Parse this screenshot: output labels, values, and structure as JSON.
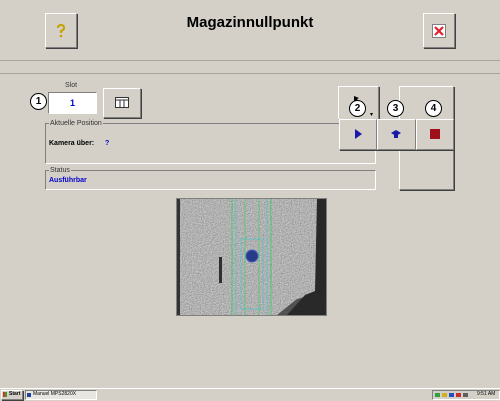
{
  "window": {
    "title": "Magazinnullpunkt"
  },
  "toolbar": {
    "help_icon": "question-icon",
    "close_icon": "close-x-icon"
  },
  "slot": {
    "label": "Slot",
    "value": "1"
  },
  "position_group": {
    "title": "Aktuelle Position",
    "camera_label": "Kamera über:",
    "camera_value": "?"
  },
  "status_group": {
    "title": "Status",
    "value": "Ausführbar"
  },
  "callouts": {
    "c1": "1",
    "c2": "2",
    "c3": "3",
    "c4": "4"
  },
  "taskbar": {
    "start_label": "Start",
    "task_label": "Manuel MPS2820X",
    "time": "9:51 AM"
  },
  "colors": {
    "accent_blue": "#0000cc",
    "play_blue": "#1a1aa8",
    "stop_red": "#a0101a",
    "close_red": "#e0202a"
  }
}
